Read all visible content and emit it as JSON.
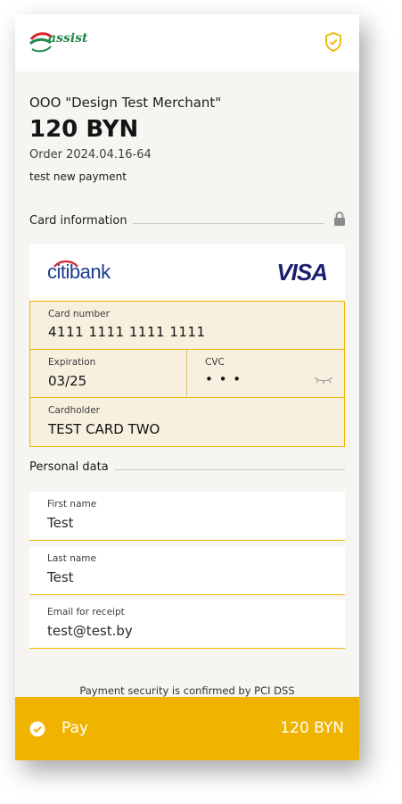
{
  "header": {
    "logo_text": "assist",
    "shield_icon": "shield-check-icon"
  },
  "summary": {
    "merchant": "OOO \"Design Test Merchant\"",
    "amount": "120 BYN",
    "order": "Order 2024.04.16-64",
    "description": "test new payment"
  },
  "card_section": {
    "title": "Card information",
    "lock_icon": "lock-icon",
    "bank_name": "citibank",
    "card_brand": "VISA",
    "card_number": {
      "label": "Card number",
      "value": "4111  1111  1111  1111"
    },
    "expiration": {
      "label": "Expiration",
      "value": "03/25"
    },
    "cvc": {
      "label": "CVC",
      "value": "• • •"
    },
    "cardholder": {
      "label": "Cardholder",
      "value": "TEST CARD TWO"
    }
  },
  "personal_section": {
    "title": "Personal data",
    "first_name": {
      "label": "First name",
      "value": "Test"
    },
    "last_name": {
      "label": "Last name",
      "value": "Test"
    },
    "email": {
      "label": "Email for receipt",
      "value": "test@test.by"
    }
  },
  "footer": {
    "security_note": "Payment security is confirmed by PCI DSS",
    "pay_label": "Pay",
    "pay_amount": "120 BYN"
  },
  "colors": {
    "accent": "#f0b400",
    "background": "#f6f5f1",
    "brand_green": "#1f8a48",
    "brand_red": "#d9232e",
    "visa_blue": "#1a1f71"
  }
}
